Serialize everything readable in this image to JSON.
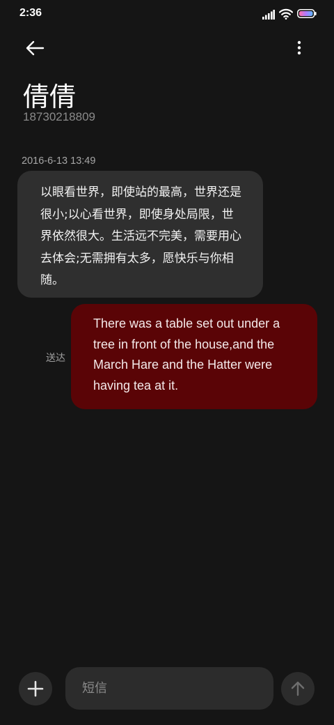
{
  "status_bar": {
    "time": "2:36",
    "icons": [
      "signal-icon",
      "wifi-icon",
      "battery-icon"
    ]
  },
  "header": {
    "back_icon": "arrow-left-icon",
    "more_icon": "more-vertical-icon",
    "contact_name": "倩倩",
    "contact_number": "18730218809"
  },
  "conversation": {
    "timestamp": "2016-6-13 13:49",
    "messages": [
      {
        "direction": "incoming",
        "text": "以眼看世界，即使站的最高，世界还是很小;以心看世界，即使身处局限，世界依然很大。生活远不完美，需要用心去体会;无需拥有太多，愿快乐与你相随。"
      },
      {
        "direction": "outgoing",
        "text": "There was a table set out under a tree in front of the house,and the March Hare and the Hatter were having tea at it.",
        "status": "送达"
      }
    ]
  },
  "composer": {
    "add_icon": "plus-icon",
    "placeholder": "短信",
    "send_icon": "arrow-up-icon"
  },
  "colors": {
    "background": "#151515",
    "incoming_bubble": "#2f2f2f",
    "outgoing_bubble": "#5a0406",
    "control_background": "#2c2c2c"
  }
}
